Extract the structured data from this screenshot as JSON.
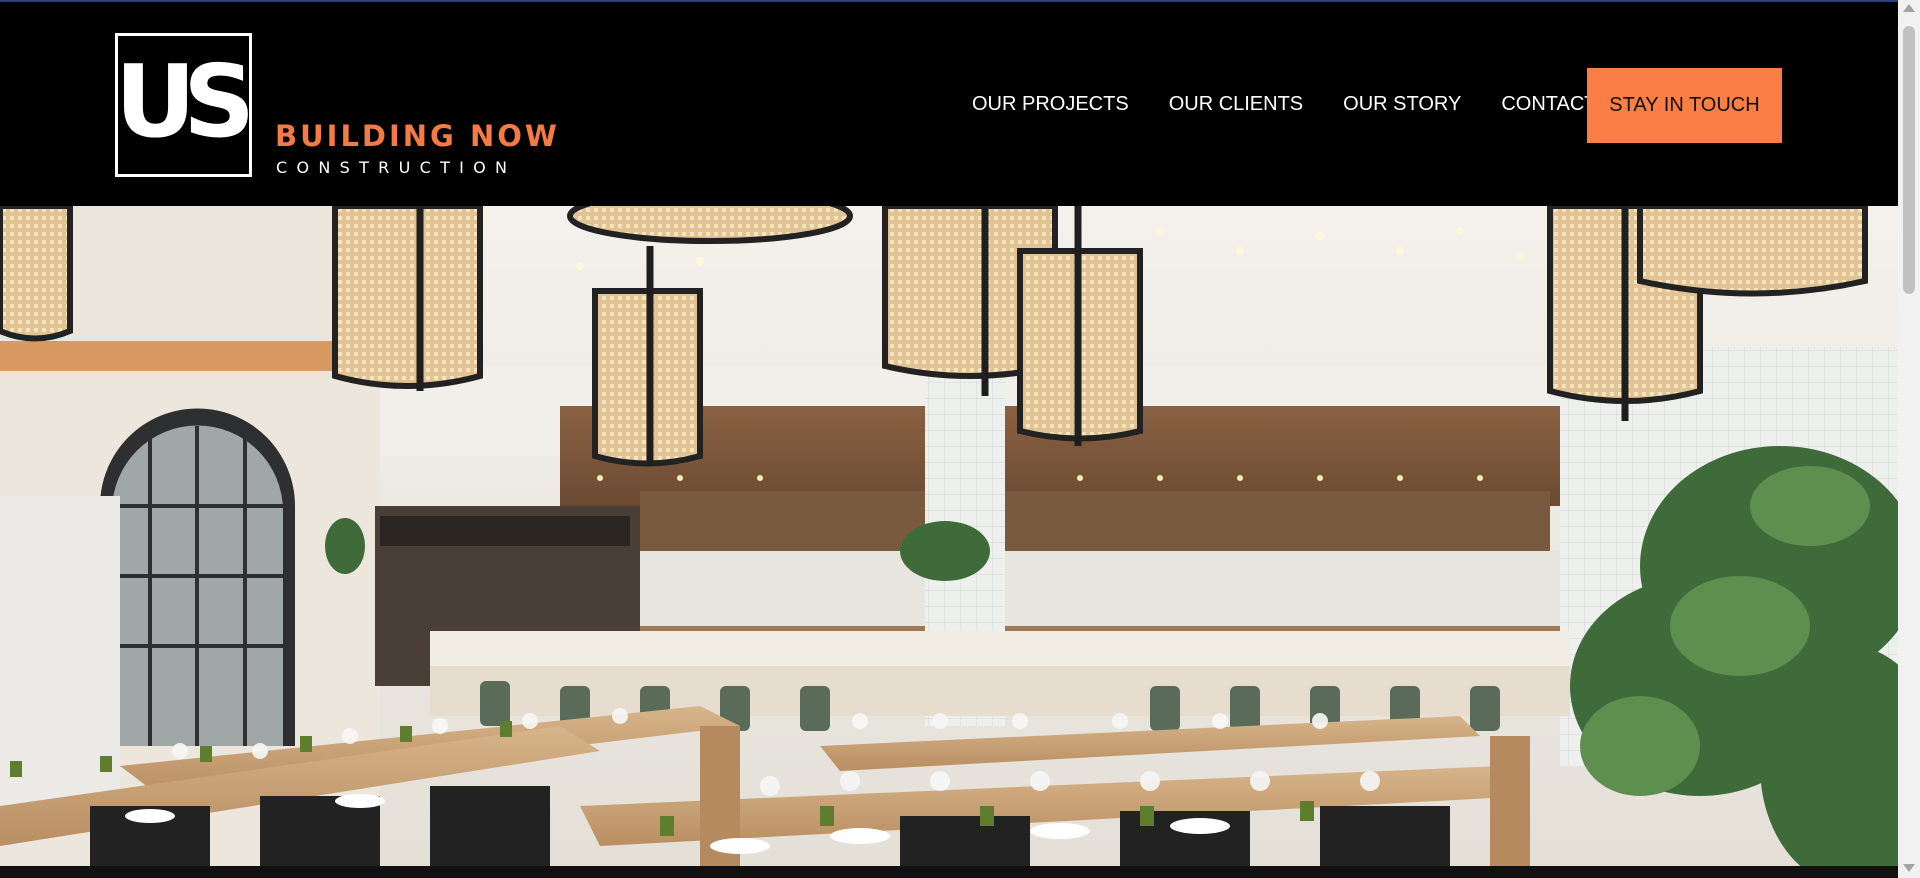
{
  "brand": {
    "logo_mark": "US",
    "name_line1": "BUILDING NOW",
    "name_line2": "CONSTRUCTION",
    "accent_color": "#f47b43"
  },
  "nav": {
    "items": [
      {
        "label": "OUR PROJECTS"
      },
      {
        "label": "OUR CLIENTS"
      },
      {
        "label": "OUR STORY"
      },
      {
        "label": "CONTACT"
      }
    ]
  },
  "cta": {
    "label": "STAY IN TOUCH",
    "color": "#fb7e47"
  },
  "hero": {
    "image": "restaurant-interior-photo"
  }
}
